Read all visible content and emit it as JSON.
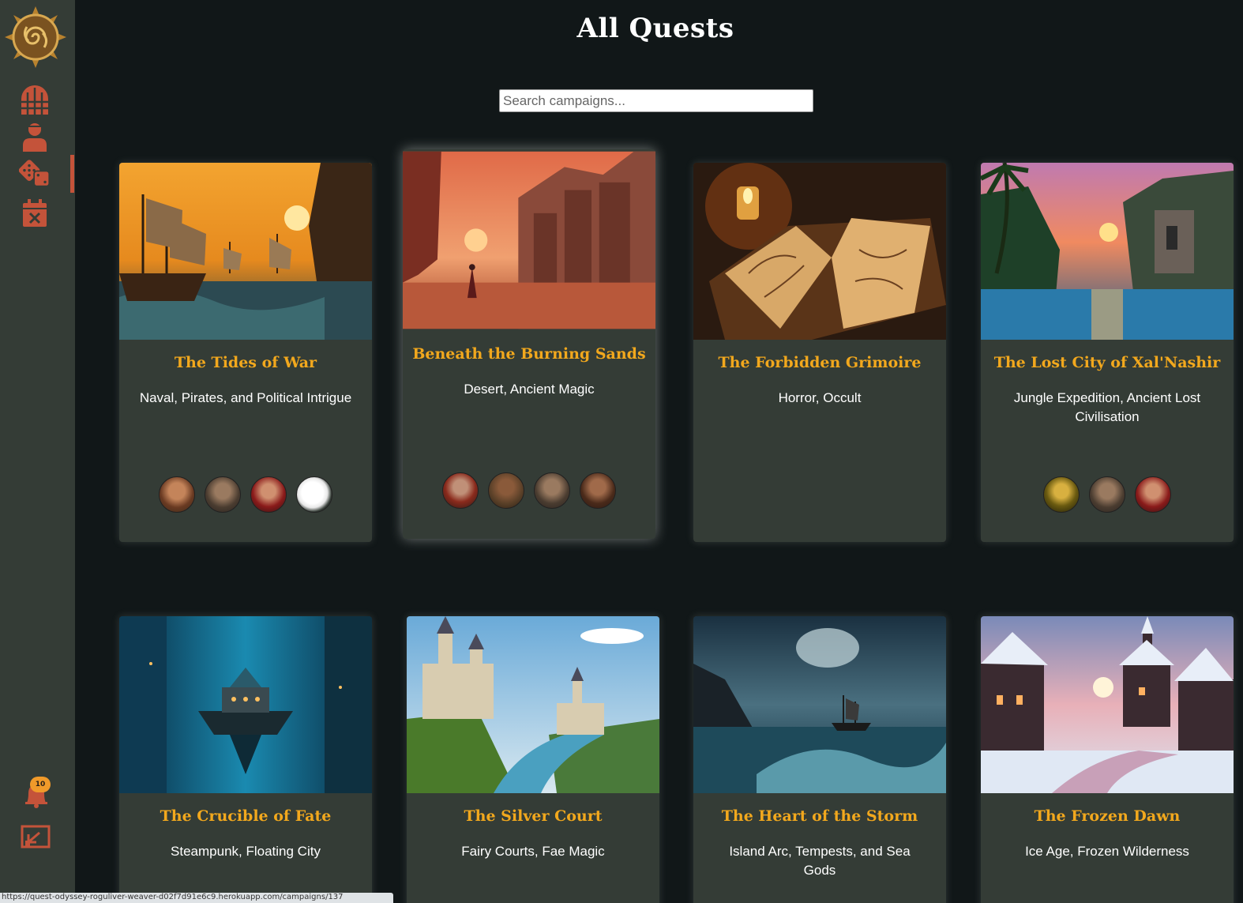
{
  "page": {
    "title": "All Quests"
  },
  "search": {
    "placeholder": "Search campaigns..."
  },
  "sidebar": {
    "logo": "swirl-sun-logo",
    "items": [
      {
        "icon": "gate-icon",
        "name": "nav-campaigns"
      },
      {
        "icon": "character-icon",
        "name": "nav-characters"
      },
      {
        "icon": "dice-icon",
        "name": "nav-dice",
        "active": true
      },
      {
        "icon": "calendar-cancel-icon",
        "name": "nav-calendar"
      }
    ],
    "notifications": {
      "icon": "bell-icon",
      "count": "10"
    },
    "logout": {
      "icon": "logout-icon"
    },
    "accent_color": "#c4533a"
  },
  "campaigns": [
    {
      "title": "The Tides of War",
      "genre": "Naval, Pirates, and Political Intrigue",
      "image": "sunset-sailing-ships",
      "players": [
        "warrior-woman",
        "armored-knight",
        "red-rogue",
        "white-rabbit-quill"
      ]
    },
    {
      "title": "Beneath the Burning Sands",
      "genre": "Desert, Ancient Magic",
      "image": "desert-ruined-city",
      "players": [
        "red-armored-warrior",
        "bearded-rogue",
        "armored-knight",
        "hooded-fighter"
      ]
    },
    {
      "title": "The Forbidden Grimoire",
      "genre": "Horror, Occult",
      "image": "candlelit-open-book",
      "players": []
    },
    {
      "title": "The Lost City of Xal'Nashir",
      "genre": "Jungle Expedition, Ancient Lost Civilisation",
      "image": "jungle-ruins-sunset",
      "players": [
        "golden-mage",
        "armored-knight",
        "red-rogue"
      ]
    },
    {
      "title": "The Crucible of Fate",
      "genre": "Steampunk, Floating City",
      "image": "floating-city-blue",
      "players": []
    },
    {
      "title": "The Silver Court",
      "genre": "Fairy Courts, Fae Magic",
      "image": "castle-river-valley",
      "players": []
    },
    {
      "title": "The Heart of the Storm",
      "genre": "Island Arc, Tempests, and Sea Gods",
      "image": "stormy-sea-ship",
      "players": []
    },
    {
      "title": "The Frozen Dawn",
      "genre": "Ice Age, Frozen Wilderness",
      "image": "snowy-village-river",
      "players": []
    }
  ],
  "status_bar": {
    "url": "https://quest-odyssey-roguliver-weaver-d02f7d91e6c9.herokuapp.com/campaigns/137"
  }
}
